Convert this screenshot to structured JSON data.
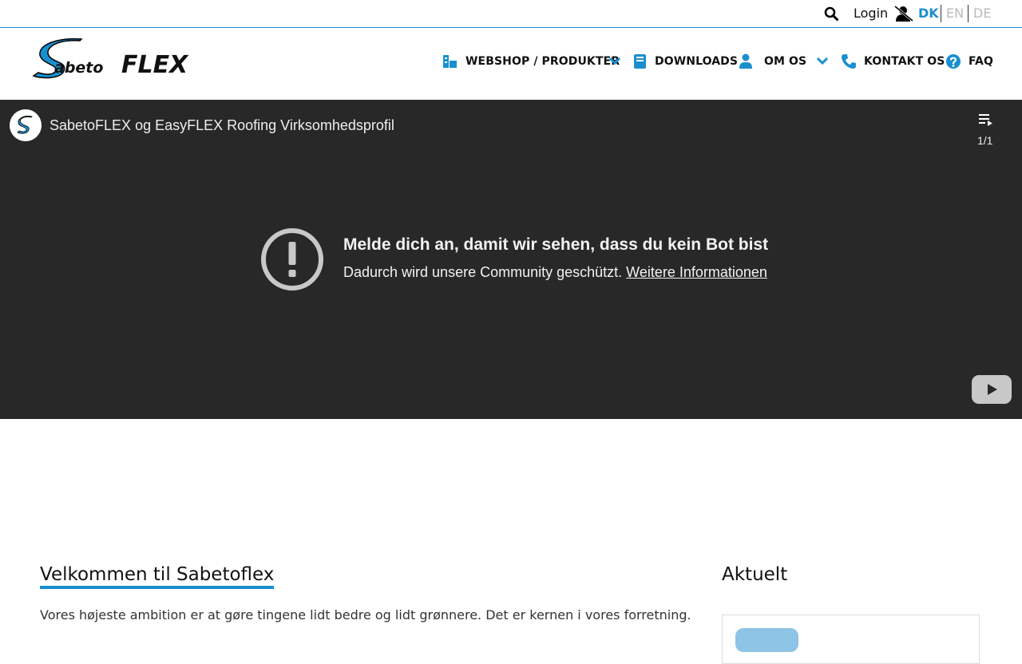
{
  "topbar": {
    "login_label": "Login",
    "languages": [
      "DK",
      "EN",
      "DE"
    ],
    "active_language": "DK",
    "icons": [
      "search-icon",
      "user-slash-icon"
    ]
  },
  "nav": {
    "items": [
      {
        "label": "WEBSHOP / PRODUKTER",
        "icon": "shop-icon",
        "has_dropdown": true
      },
      {
        "label": "DOWNLOADS",
        "icon": "book-icon",
        "has_dropdown": false
      },
      {
        "label": "OM OS",
        "icon": "user-icon",
        "has_dropdown": true
      },
      {
        "label": "KONTAKT OS",
        "icon": "phone-icon",
        "has_dropdown": false
      },
      {
        "label": "FAQ",
        "icon": "question-circle-icon",
        "has_dropdown": false
      }
    ]
  },
  "video": {
    "title": "SabetoFLEX og EasyFLEX Roofing Virksomhedsprofil",
    "playlist_count": "1/1",
    "error_title": "Melde dich an, damit wir sehen, dass du kein Bot bist",
    "error_text": "Dadurch wird unsere Community geschützt.",
    "error_link": "Weitere Informationen"
  },
  "main": {
    "heading": "Velkommen til Sabetoflex",
    "intro": "Vores højeste ambition er at gøre tingene lidt bedre og lidt grønnere. Det er kernen i vores forretning."
  },
  "sidebar": {
    "heading": "Aktuelt"
  },
  "colors": {
    "accent": "#1a8fcf",
    "video_bg": "#282828",
    "inactive_lang": "#bbbbbb"
  }
}
